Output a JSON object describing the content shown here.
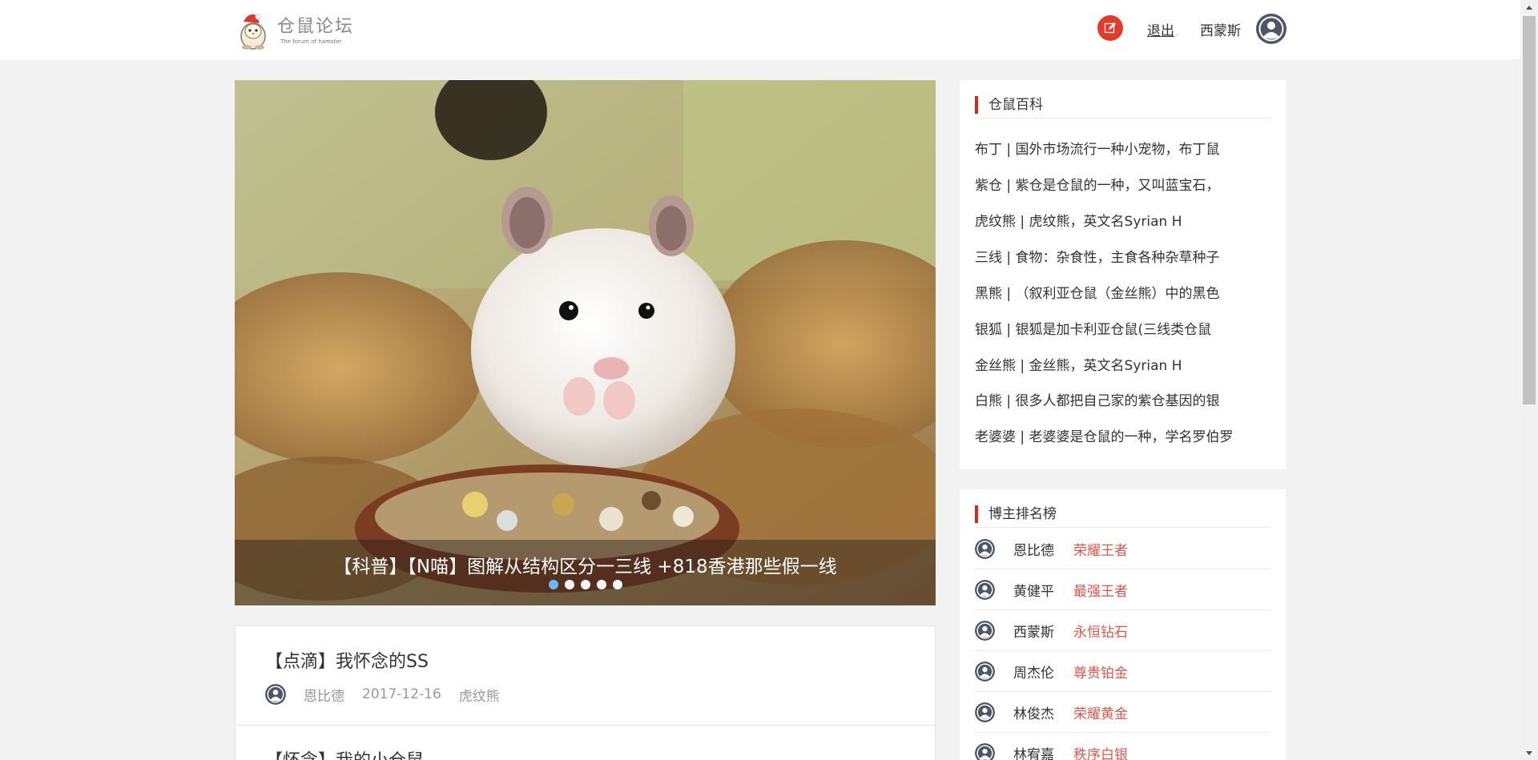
{
  "header": {
    "logo_title": "仓鼠论坛",
    "logo_subtitle": "The forum of hamster",
    "write_icon": "edit-icon",
    "logout_label": "退出",
    "username": "西蒙斯",
    "avatar_icon": "user-avatar-icon"
  },
  "carousel": {
    "caption": "【科普】【N喵】图解从结构区分一三线 +818香港那些假一线",
    "slide_count": 5,
    "active_slide": 1
  },
  "posts": [
    {
      "title": "【点滴】我怀念的SS",
      "author": "恩比德",
      "date": "2017-12-16",
      "tag": "虎纹熊"
    },
    {
      "title": "【怀念】我的小仓鼠",
      "author": "",
      "date": "",
      "tag": ""
    }
  ],
  "wiki": {
    "title": "仓鼠百科",
    "items": [
      "布丁 | 国外市场流行一种小宠物，布丁鼠",
      "紫仓 | 紫仓是仓鼠的一种，又叫蓝宝石，",
      "虎纹熊 | 虎纹熊，英文名Syrian H",
      "三线 | 食物：杂食性，主食各种杂草种子",
      "黑熊 | （叙利亚仓鼠（金丝熊）中的黑色",
      "银狐 | 银狐是加卡利亚仓鼠(三线类仓鼠",
      "金丝熊 | 金丝熊，英文名Syrian H",
      "白熊 | 很多人都把自己家的紫仓基因的银",
      "老婆婆 | 老婆婆是仓鼠的一种，学名罗伯罗"
    ]
  },
  "ranking": {
    "title": "博主排名榜",
    "rows": [
      {
        "name": "恩比德",
        "rank": "荣耀王者"
      },
      {
        "name": "黄健平",
        "rank": "最强王者"
      },
      {
        "name": "西蒙斯",
        "rank": "永恒钻石"
      },
      {
        "name": "周杰伦",
        "rank": "尊贵铂金"
      },
      {
        "name": "林俊杰",
        "rank": "荣耀黄金"
      },
      {
        "name": "林宥嘉",
        "rank": "秩序白银"
      }
    ]
  },
  "colors": {
    "accent_red": "#e33b2a",
    "rank_red": "#e3574b",
    "dot_active": "#6ab9f5"
  }
}
